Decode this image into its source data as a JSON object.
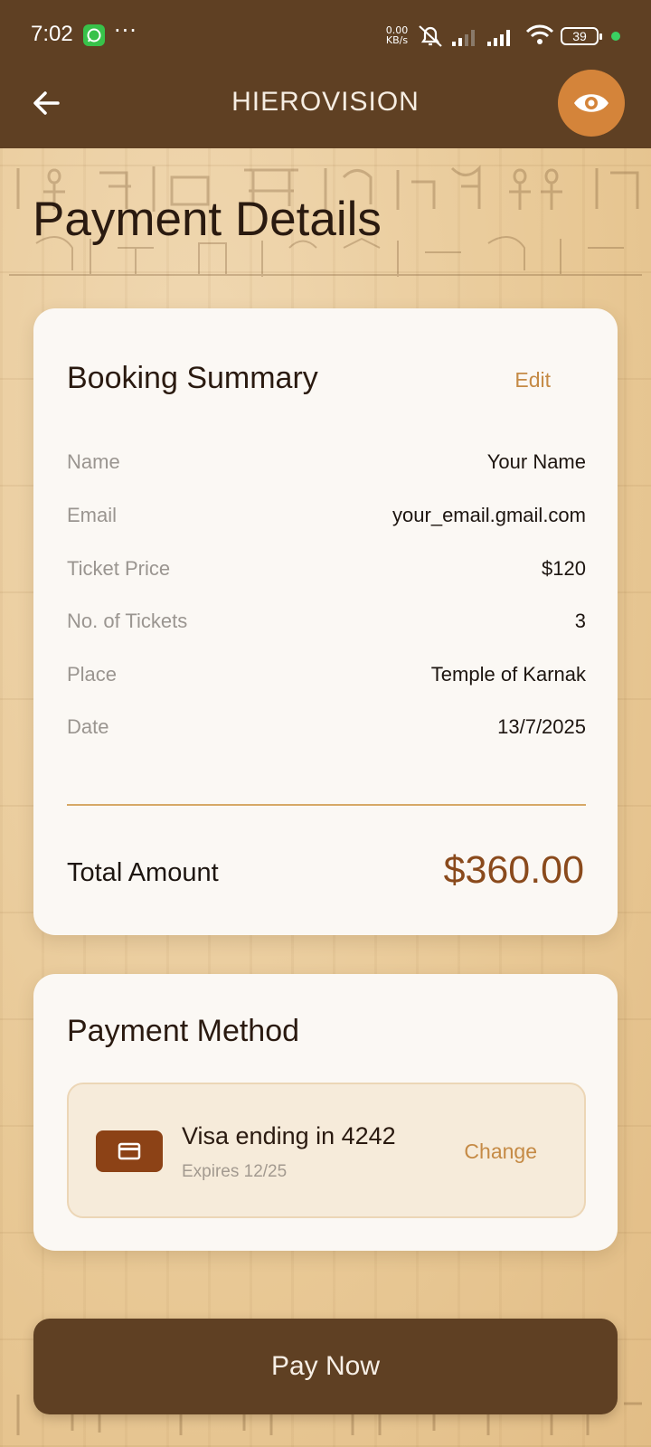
{
  "status_bar": {
    "time": "7:02",
    "net_speed_value": "0.00",
    "net_speed_unit": "KB/s",
    "battery": "39"
  },
  "app_bar": {
    "title": "HIEROVISION",
    "back_icon": "arrow-left-icon",
    "action_icon": "eye-icon",
    "action_color": "#d4843a",
    "bar_color": "#5f4023"
  },
  "page": {
    "title": "Payment Details"
  },
  "booking_summary": {
    "heading": "Booking Summary",
    "edit_label": "Edit",
    "rows": [
      {
        "label": "Name",
        "value": "Your Name"
      },
      {
        "label": "Email",
        "value": "your_email.gmail.com"
      },
      {
        "label": "Ticket Price",
        "value": "$120"
      },
      {
        "label": "No. of Tickets",
        "value": "3"
      },
      {
        "label": "Place",
        "value": "Temple of Karnak"
      },
      {
        "label": "Date",
        "value": "13/7/2025"
      }
    ],
    "total_label": "Total Amount",
    "total_value": "$360.00"
  },
  "payment_method": {
    "heading": "Payment Method",
    "card_name": "Visa ending in 4242",
    "card_expiry": "Expires 12/25",
    "change_label": "Change",
    "card_icon": "credit-card-icon"
  },
  "pay_button": {
    "label": "Pay Now"
  },
  "colors": {
    "accent": "#c58a45",
    "total": "#8a4a1c",
    "background": "#ebcfa3"
  }
}
